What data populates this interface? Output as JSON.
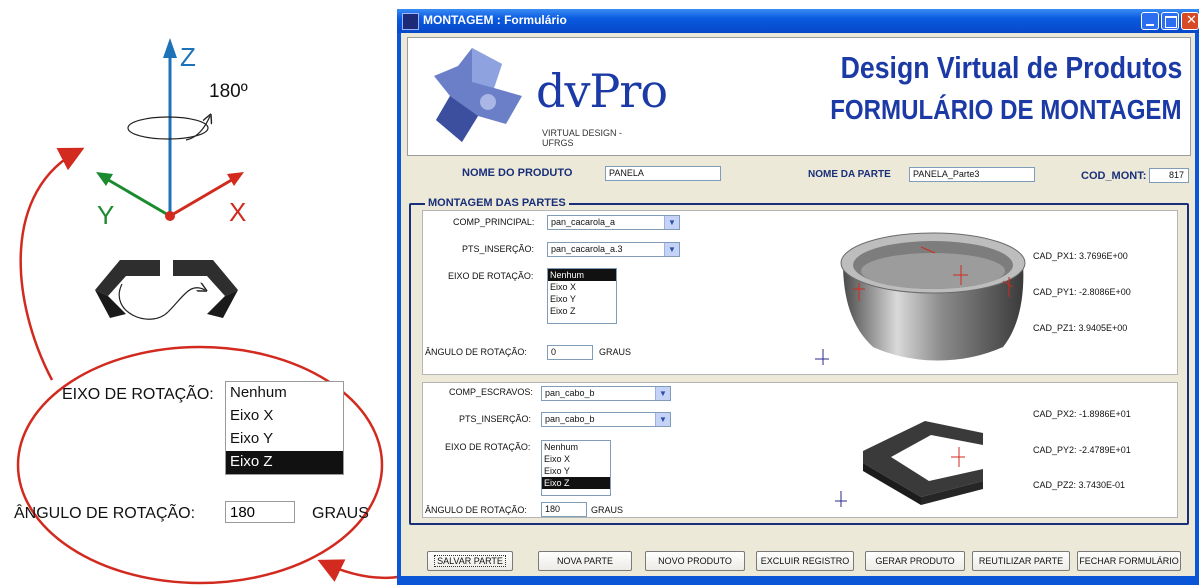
{
  "annotation": {
    "axes": {
      "z": "Z",
      "y": "Y",
      "x": "X"
    },
    "rotation_label": "180º",
    "eixo_label": "EIXO DE ROTAÇÃO:",
    "eixo_options": [
      "Nenhum",
      "Eixo X",
      "Eixo Y",
      "Eixo Z"
    ],
    "eixo_selected": "Eixo Z",
    "angulo_label": "ÂNGULO DE ROTAÇÃO:",
    "angulo_value": "180",
    "graus": "GRAUS"
  },
  "window": {
    "title": "MONTAGEM : Formulário",
    "header": {
      "logo_text": "dvPro",
      "logo_sub": "VIRTUAL DESIGN - UFRGS",
      "title1": "Design Virtual de Produtos",
      "title2": "FORMULÁRIO DE MONTAGEM"
    },
    "top_fields": {
      "nome_produto_label": "NOME DO PRODUTO",
      "nome_produto_value": "PANELA",
      "nome_parte_label": "NOME DA PARTE",
      "nome_parte_value": "PANELA_Parte3",
      "cod_mont_label": "COD_MONT:",
      "cod_mont_value": "817"
    },
    "group_title": "MONTAGEM DAS PARTES",
    "principal": {
      "comp_label": "COMP_PRINCIPAL:",
      "comp_value": "pan_cacarola_a",
      "pts_label": "PTS_INSERÇÃO:",
      "pts_value": "pan_cacarola_a.3",
      "eixo_label": "EIXO DE ROTAÇÃO:",
      "eixo_options": [
        "Nenhum",
        "Eixo X",
        "Eixo Y",
        "Eixo Z"
      ],
      "eixo_selected": "Nenhum",
      "angulo_label": "ÂNGULO DE ROTAÇÃO:",
      "angulo_value": "0",
      "graus": "GRAUS",
      "cad": [
        "CAD_PX1: 3.7696E+00",
        "CAD_PY1: -2.8086E+00",
        "CAD_PZ1: 3.9405E+00"
      ]
    },
    "escravos": {
      "comp_label": "COMP_ESCRAVOS:",
      "comp_value": "pan_cabo_b",
      "pts_label": "PTS_INSERÇÃO:",
      "pts_value": "pan_cabo_b",
      "eixo_label": "EIXO DE ROTAÇÃO:",
      "eixo_options": [
        "Nenhum",
        "Eixo X",
        "Eixo Y",
        "Eixo Z"
      ],
      "eixo_selected": "Eixo Z",
      "angulo_label": "ÂNGULO DE ROTAÇÃO:",
      "angulo_value": "180",
      "graus": "GRAUS",
      "cad": [
        "CAD_PX2: -1.8986E+01",
        "CAD_PY2: -2.4789E+01",
        "CAD_PZ2: 3.7430E-01"
      ]
    },
    "buttons": [
      "SALVAR PARTE",
      "NOVA PARTE",
      "NOVO PRODUTO",
      "EXCLUIR REGISTRO",
      "GERAR PRODUTO",
      "REUTILIZAR PARTE",
      "FECHAR FORMULÁRIO"
    ]
  },
  "colors": {
    "annotation_red": "#d22a1e",
    "axis_blue": "#1e72b8",
    "axis_green": "#1c8a2e",
    "title_blue": "#1a2f7a"
  }
}
